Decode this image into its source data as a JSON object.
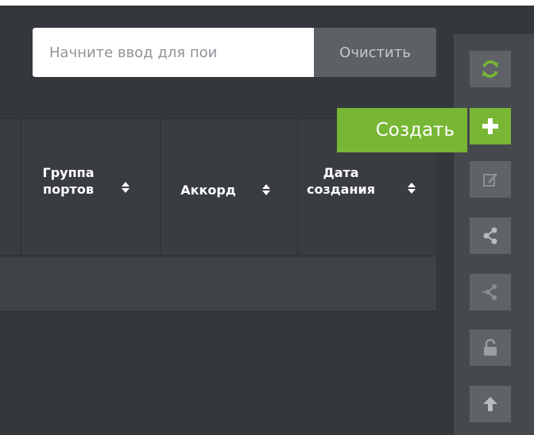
{
  "search": {
    "placeholder": "Начните ввод для пои",
    "clear_label": "Очистить"
  },
  "table": {
    "columns": [
      {
        "label": "Группа портов",
        "sortable": true
      },
      {
        "label": "Аккорд",
        "sortable": true
      },
      {
        "label": "Дата создания",
        "sortable": true
      }
    ]
  },
  "toolbar": {
    "tooltip": "Создать",
    "buttons": [
      {
        "name": "refresh-button",
        "icon": "refresh-icon"
      },
      {
        "name": "create-button",
        "icon": "plus-icon",
        "active": true
      },
      {
        "name": "edit-button",
        "icon": "edit-icon"
      },
      {
        "name": "share-button",
        "icon": "share-icon"
      },
      {
        "name": "unshare-button",
        "icon": "unshare-icon"
      },
      {
        "name": "unlock-button",
        "icon": "unlock-icon"
      },
      {
        "name": "upload-button",
        "icon": "arrow-up-icon"
      }
    ]
  },
  "colors": {
    "accent": "#78b735",
    "background": "#34373b",
    "header": "#393c40",
    "toolbar": "#45484d",
    "toolbar_button": "#5f6368"
  }
}
